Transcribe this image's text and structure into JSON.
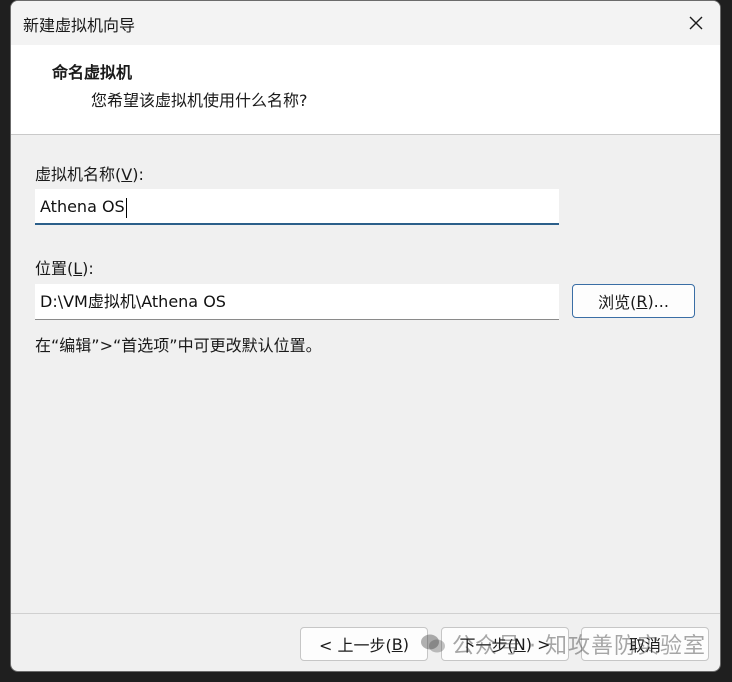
{
  "window": {
    "title": "新建虚拟机向导"
  },
  "header": {
    "title": "命名虚拟机",
    "subtitle": "您希望该虚拟机使用什么名称?"
  },
  "vm_name": {
    "label_prefix": "虚拟机名称(",
    "label_key": "V",
    "label_suffix": "):",
    "value": "Athena OS"
  },
  "location": {
    "label_prefix": "位置(",
    "label_key": "L",
    "label_suffix": "):",
    "value": "D:\\VM虚拟机\\Athena OS",
    "browse_prefix": "浏览(",
    "browse_key": "R",
    "browse_suffix": ")..."
  },
  "hint": "在“编辑”>“首选项”中可更改默认位置。",
  "footer": {
    "back_prefix": "< 上一步(",
    "back_key": "B",
    "back_suffix": ")",
    "next_prefix": "下一步(",
    "next_key": "N",
    "next_suffix": ") >",
    "cancel_label": "取消"
  },
  "watermark": "公众号 · 知攻善防实验室",
  "colors": {
    "accent": "#2b5f8a",
    "window_bg": "#f0f0f0"
  }
}
